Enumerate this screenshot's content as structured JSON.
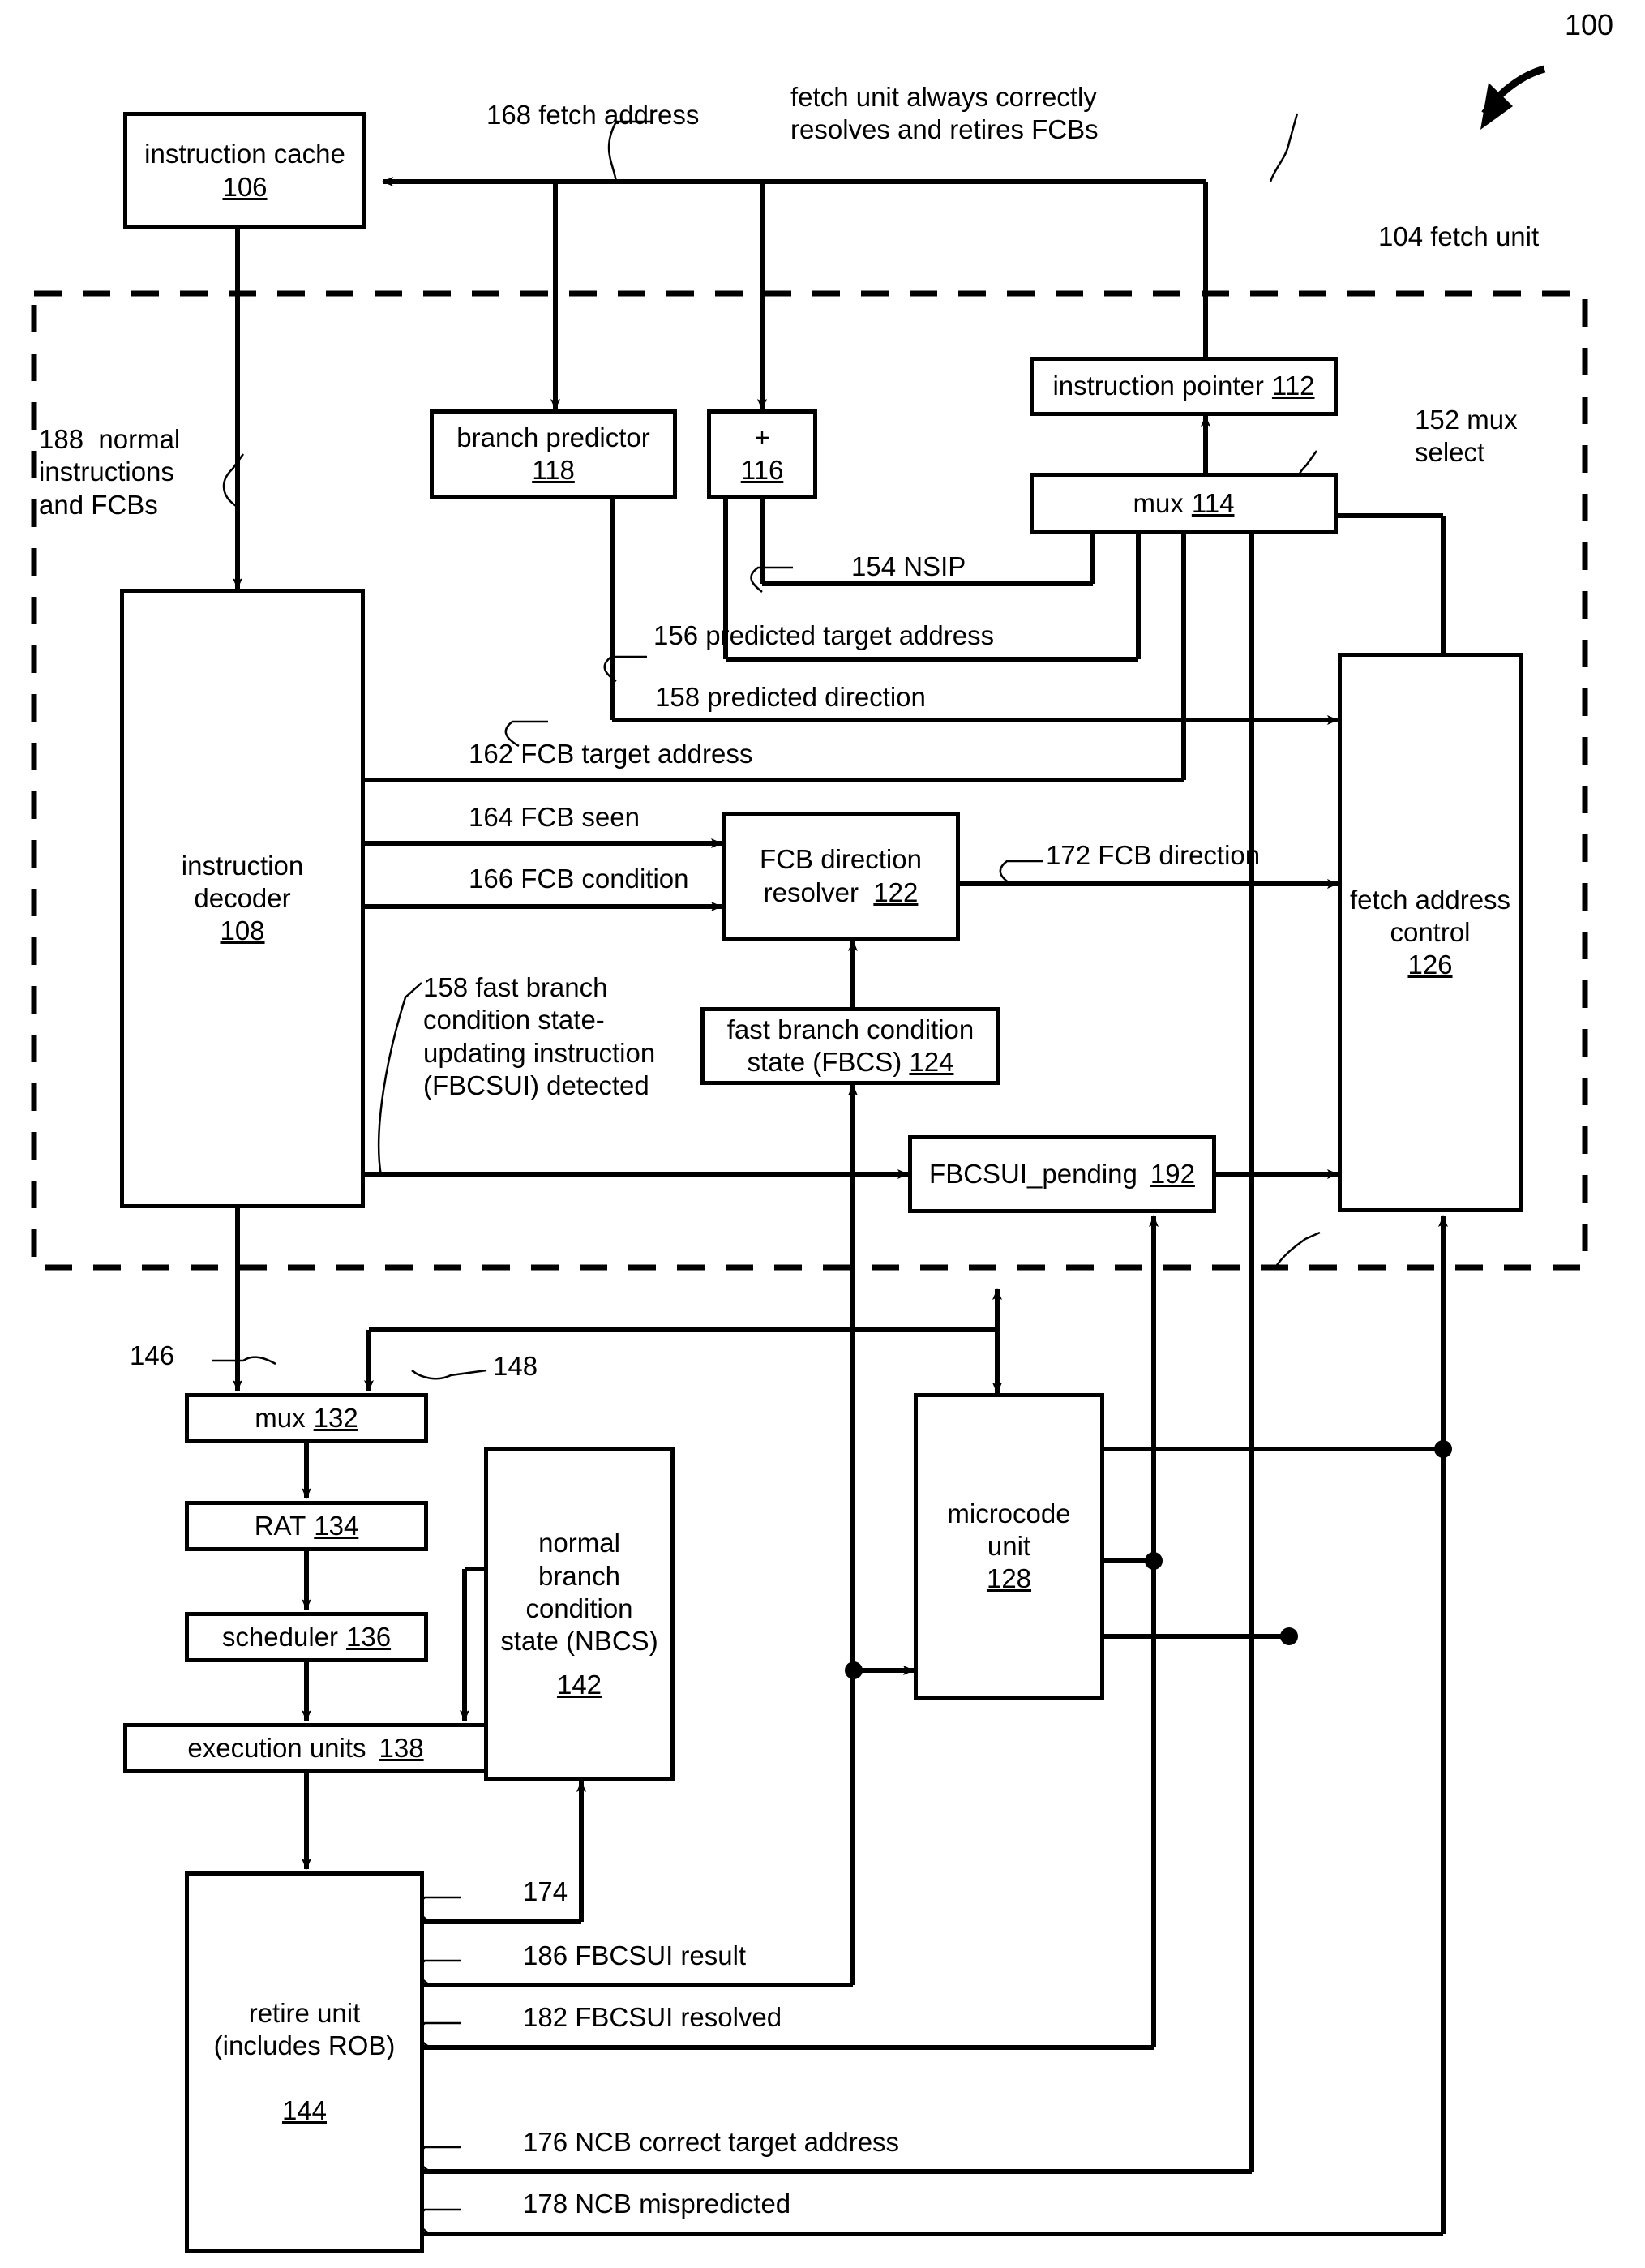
{
  "figure": {
    "number": "100",
    "dashed_region_label": "104 fetch unit",
    "note_fetch_unit": "fetch unit always correctly\nresolves and retires FCBs"
  },
  "blocks": {
    "instruction_cache": {
      "title": "instruction cache",
      "num": "106"
    },
    "branch_predictor": {
      "title": "branch predictor",
      "num": "118"
    },
    "adder": {
      "title": "+",
      "num": "116"
    },
    "instruction_pointer": {
      "title": "instruction pointer",
      "num": "112"
    },
    "mux114": {
      "title": "mux",
      "num": "114"
    },
    "instruction_decoder": {
      "title": "instruction\ndecoder",
      "num": "108"
    },
    "fcb_direction_resolver": {
      "title": "FCB direction\nresolver",
      "num": "122"
    },
    "fbcs": {
      "title": "fast branch condition\nstate (FBCS)",
      "num": "124"
    },
    "fbcsui_pending": {
      "title": "FBCSUI_pending",
      "num": "192"
    },
    "fetch_address_control": {
      "title": "fetch address\ncontrol",
      "num": "126"
    },
    "mux132": {
      "title": "mux",
      "num": "132"
    },
    "rat": {
      "title": "RAT",
      "num": "134"
    },
    "scheduler": {
      "title": "scheduler",
      "num": "136"
    },
    "execution_units": {
      "title": "execution units",
      "num": "138"
    },
    "nbcs": {
      "title": "normal\nbranch\ncondition\nstate (NBCS)",
      "num": "142"
    },
    "microcode_unit": {
      "title": "microcode\nunit",
      "num": "128"
    },
    "retire_unit": {
      "title": "retire unit\n(includes ROB)",
      "num": "144"
    }
  },
  "signals": {
    "s168": "168 fetch address",
    "s188": "188  normal\ninstructions\nand FCBs",
    "s152": "152 mux\nselect",
    "s154": "154 NSIP",
    "s156": "156 predicted target address",
    "s158p": "158 predicted direction",
    "s162": "162 FCB target address",
    "s164": "164 FCB seen",
    "s166": "166 FCB condition",
    "s172": "172 FCB direction",
    "s158f": "158 fast branch\ncondition state-\nupdating instruction\n(FBCSUI) detected",
    "s146": "146",
    "s148": "148",
    "s174": "174",
    "s186": "186 FBCSUI result",
    "s182": "182 FBCSUI resolved",
    "s176": "176 NCB correct target address",
    "s178": "178 NCB mispredicted"
  },
  "colors": {
    "ink": "#000000",
    "paper": "#ffffff"
  }
}
